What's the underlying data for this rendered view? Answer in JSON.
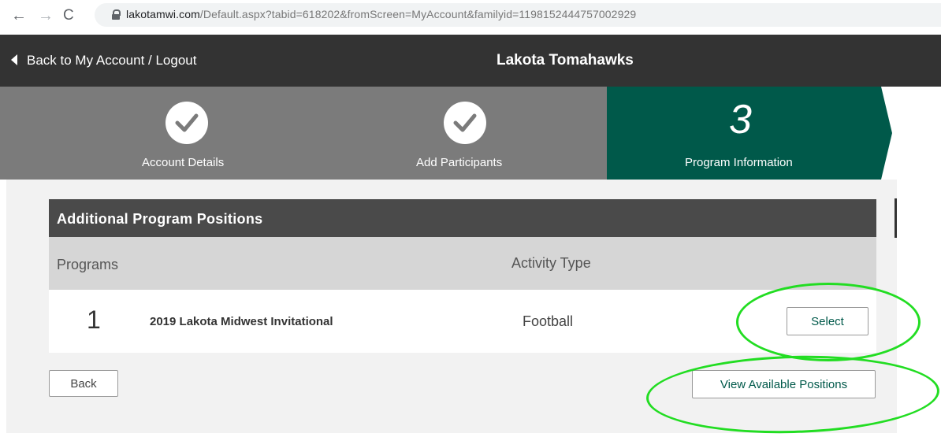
{
  "browser": {
    "url_domain": "lakotamwi.com",
    "url_path": "/Default.aspx?tabid=618202&fromScreen=MyAccount&familyid=1198152444757002929"
  },
  "header": {
    "back_link": "Back to My Account / Logout",
    "title": "Lakota Tomahawks"
  },
  "steps": [
    {
      "label": "Account Details",
      "status": "complete"
    },
    {
      "label": "Add Participants",
      "status": "complete"
    },
    {
      "label": "Program Information",
      "number": "3",
      "status": "active"
    }
  ],
  "panel": {
    "title": "Additional Program Positions",
    "columns": {
      "programs": "Programs",
      "activity_type": "Activity Type"
    },
    "rows": [
      {
        "number": "1",
        "name": "2019 Lakota Midwest Invitational",
        "activity": "Football",
        "action": "Select"
      }
    ]
  },
  "buttons": {
    "back": "Back",
    "view_positions": "View Available Positions"
  },
  "colors": {
    "header_bg": "#333333",
    "step_done": "#7b7b7b",
    "step_active": "#00594a",
    "annotation": "#22dd22"
  }
}
